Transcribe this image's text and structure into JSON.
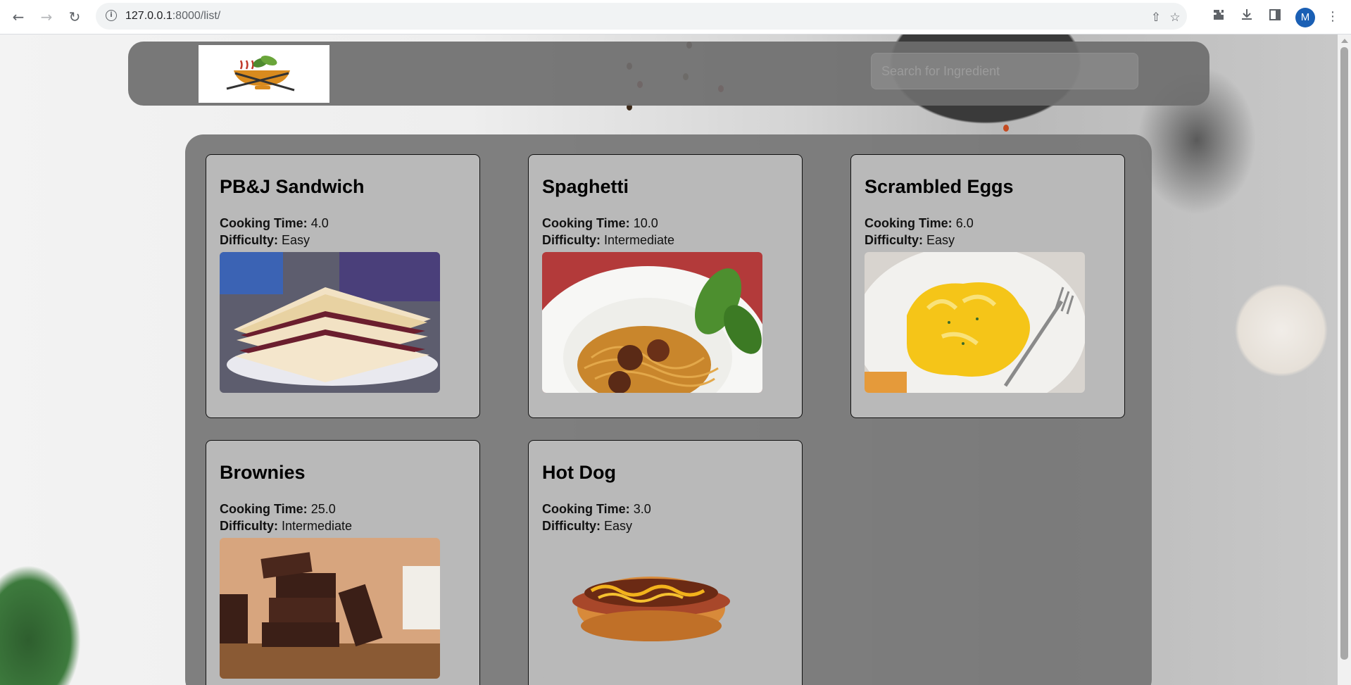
{
  "browser": {
    "url_host": "127.0.0.1",
    "url_path": ":8000/list/",
    "avatar_letter": "M"
  },
  "header": {
    "search_placeholder": "Search for Ingredient"
  },
  "labels": {
    "cooking_time": "Cooking Time:",
    "difficulty": "Difficulty:"
  },
  "recipes": [
    {
      "name": "PB&J Sandwich",
      "cooking_time": "4.0",
      "difficulty": "Easy",
      "image": "pbj-sandwich-photo"
    },
    {
      "name": "Spaghetti",
      "cooking_time": "10.0",
      "difficulty": "Intermediate",
      "image": "spaghetti-photo"
    },
    {
      "name": "Scrambled Eggs",
      "cooking_time": "6.0",
      "difficulty": "Easy",
      "image": "scrambled-eggs-photo"
    },
    {
      "name": "Brownies",
      "cooking_time": "25.0",
      "difficulty": "Intermediate",
      "image": "brownies-photo"
    },
    {
      "name": "Hot Dog",
      "cooking_time": "3.0",
      "difficulty": "Easy",
      "image": "hot-dog-photo"
    }
  ]
}
